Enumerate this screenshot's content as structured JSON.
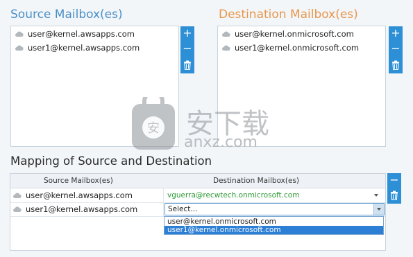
{
  "source": {
    "title": "Source Mailbox(es)",
    "items": [
      "user@kernel.awsapps.com",
      "user1@kernel.awsapps.com"
    ]
  },
  "destination": {
    "title": "Destination Mailbox(es)",
    "items": [
      "user@kernel.onmicrosoft.com",
      "user1@kernel.onmicrosoft.com"
    ]
  },
  "buttons": {
    "add": "+",
    "remove": "−"
  },
  "mapping": {
    "title": "Mapping of Source and Destination",
    "col_source": "Source Mailbox(es)",
    "col_destination": "Destination Mailbox(es)",
    "rows": [
      {
        "source": "user@kernel.awsapps.com",
        "destination": "vguerra@recwtech.onmicrosoft.com"
      },
      {
        "source": "user1@kernel.awsapps.com",
        "destination": "Select..."
      }
    ],
    "dropdown_options": [
      "user@kernel.onmicrosoft.com",
      "user1@kernel.onmicrosoft.com"
    ],
    "dropdown_selected_index": 1
  },
  "watermark": {
    "text": "anxz.com",
    "brand": "安下载"
  },
  "colors": {
    "source_title": "#4a90c8",
    "destination_title": "#e8964a",
    "accent": "#2d8fd5",
    "assigned_text": "#2e9a36"
  }
}
